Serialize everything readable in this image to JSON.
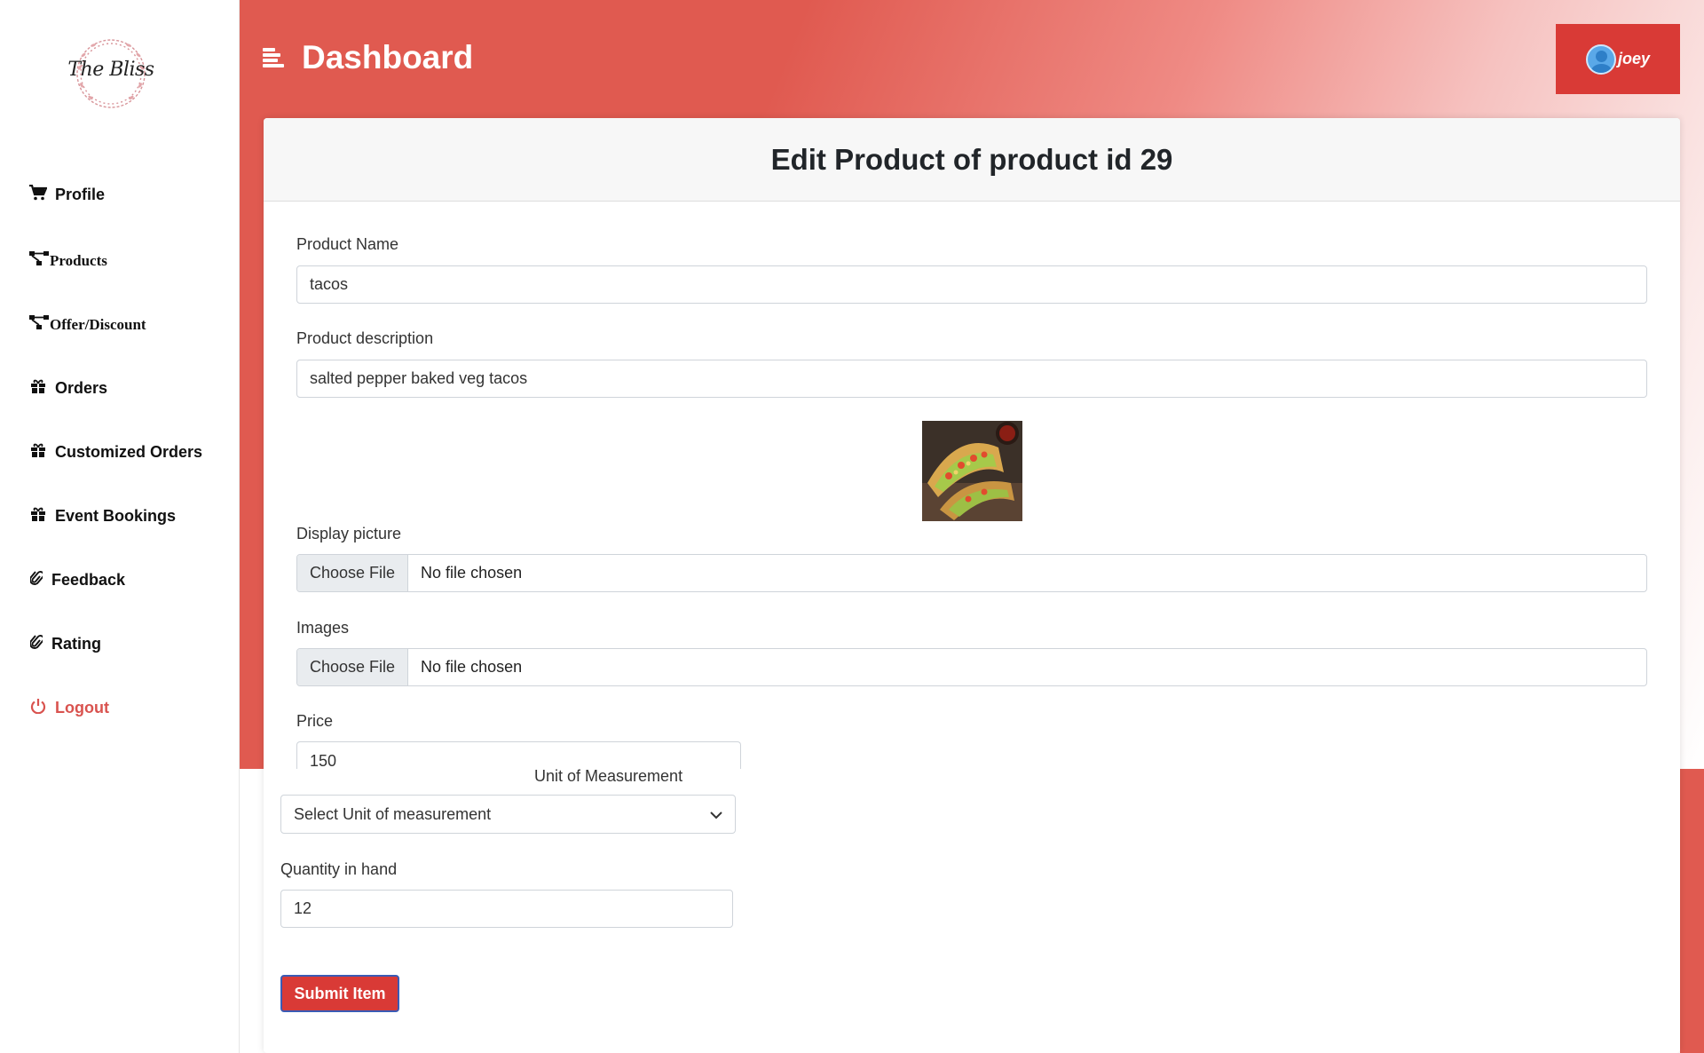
{
  "brand": {
    "logo_text": "The Bliss"
  },
  "sidebar": {
    "items": [
      {
        "label": "Profile",
        "icon": "cart-icon"
      },
      {
        "label": "Products",
        "icon": "sitemap-icon"
      },
      {
        "label": "Offer/Discount",
        "icon": "sitemap-icon"
      },
      {
        "label": "Orders",
        "icon": "gift-icon"
      },
      {
        "label": "Customized Orders",
        "icon": "gift-icon"
      },
      {
        "label": "Event Bookings",
        "icon": "gift-icon"
      },
      {
        "label": "Feedback",
        "icon": "paperclip-icon"
      },
      {
        "label": "Rating",
        "icon": "paperclip-icon"
      },
      {
        "label": "Logout",
        "icon": "power-icon"
      }
    ]
  },
  "header": {
    "title": "Dashboard",
    "user": {
      "name": "joey"
    }
  },
  "form": {
    "title": "Edit Product of product id 29",
    "product_name": {
      "label": "Product Name",
      "value": "tacos"
    },
    "product_description": {
      "label": "Product description",
      "value": "salted pepper baked veg tacos"
    },
    "display_picture": {
      "label": "Display picture",
      "button": "Choose File",
      "status": "No file chosen"
    },
    "images": {
      "label": "Images",
      "button": "Choose File",
      "status": "No file chosen"
    },
    "price": {
      "label": "Price",
      "value": "150"
    },
    "unit": {
      "label": "Unit of Measurement",
      "selected": "Select Unit of measurement"
    },
    "quantity": {
      "label": "Quantity in hand",
      "value": "12"
    },
    "submit_label": "Submit Item"
  },
  "colors": {
    "accent": "#d93a36",
    "header_gradient_start": "#e05a50",
    "logout": "#d9534f"
  }
}
